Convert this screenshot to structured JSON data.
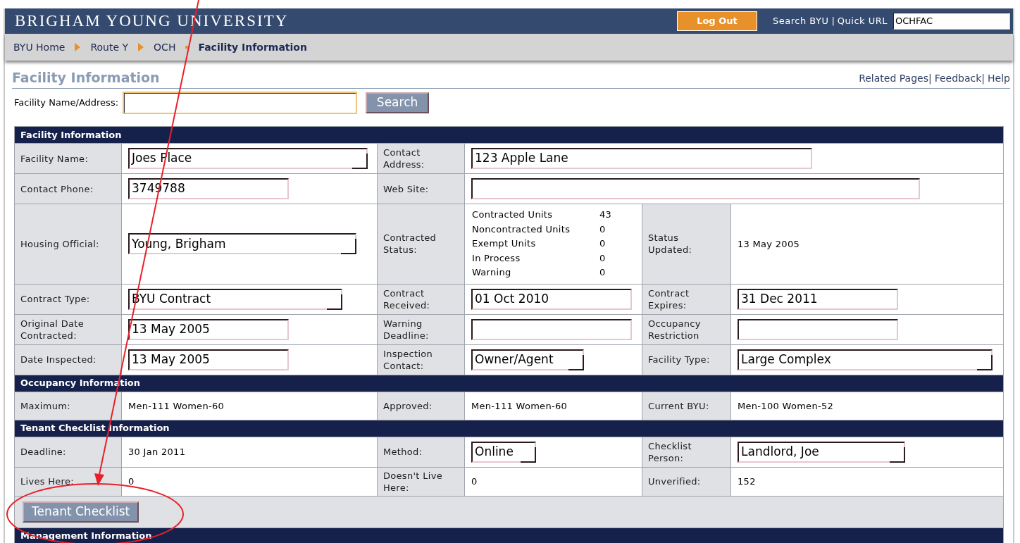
{
  "header": {
    "title": "BRIGHAM YOUNG UNIVERSITY",
    "logout": "Log Out",
    "search_link": "Search BYU",
    "separator": "|",
    "quick_url_label": "Quick URL",
    "quick_url": "OCHFAC"
  },
  "breadcrumb": [
    {
      "label": "BYU Home",
      "current": false
    },
    {
      "label": "Route Y",
      "current": false
    },
    {
      "label": "OCH",
      "current": false
    },
    {
      "label": "Facility Information",
      "current": true
    }
  ],
  "page": {
    "title": "Facility Information",
    "links": [
      "Related Pages|",
      "Feedback|",
      "Help"
    ]
  },
  "search": {
    "label": "Facility Name/Address:",
    "button": "Search"
  },
  "sections": [
    {
      "title": "Facility Information",
      "rows": [
        [
          {
            "kind": "label",
            "text": "Facility Name:"
          },
          {
            "kind": "select",
            "value": "Joes Place"
          },
          {
            "kind": "label",
            "text": "Contact Address:"
          },
          {
            "kind": "input",
            "value": "123 Apple Lane",
            "colspan": 3
          }
        ],
        [
          {
            "kind": "label",
            "text": "Contact Phone:"
          },
          {
            "kind": "input",
            "value": "3749788"
          },
          {
            "kind": "label",
            "text": "Web Site:"
          },
          {
            "kind": "input",
            "colspan": 3
          }
        ],
        [
          {
            "kind": "label",
            "text": "Housing Official:"
          },
          {
            "kind": "select",
            "value": "Young, Brigham"
          },
          {
            "kind": "label",
            "text": "Contracted Status:"
          },
          {
            "kind": "units",
            "items": [
              {
                "label": "Contracted Units",
                "value": "43"
              },
              {
                "label": "Noncontracted Units",
                "value": "0"
              },
              {
                "label": "Exempt Units",
                "value": "0"
              },
              {
                "label": "In Process",
                "value": "0"
              },
              {
                "label": "Warning",
                "value": "0"
              }
            ]
          },
          {
            "kind": "label",
            "text": "Status Updated:"
          },
          {
            "kind": "text",
            "text": "13 May 2005"
          }
        ],
        [
          {
            "kind": "label",
            "text": "Contract Type:"
          },
          {
            "kind": "select",
            "value": "BYU Contract"
          },
          {
            "kind": "label",
            "text": "Contract Received:"
          },
          {
            "kind": "input",
            "value": "01 Oct 2010"
          },
          {
            "kind": "label",
            "text": "Contract Expires:"
          },
          {
            "kind": "input",
            "value": "31 Dec 2011"
          }
        ],
        [
          {
            "kind": "label",
            "text": "Original Date Contracted:"
          },
          {
            "kind": "input",
            "value": "13 May 2005"
          },
          {
            "kind": "label",
            "text": "Warning Deadline:"
          },
          {
            "kind": "input"
          },
          {
            "kind": "label",
            "text": "Occupancy Restriction"
          },
          {
            "kind": "input"
          }
        ],
        [
          {
            "kind": "label",
            "text": "Date Inspected:"
          },
          {
            "kind": "input",
            "value": "13 May 2005"
          },
          {
            "kind": "label",
            "text": "Inspection Contact:"
          },
          {
            "kind": "select",
            "value": "Owner/Agent"
          },
          {
            "kind": "label",
            "text": "Facility Type:"
          },
          {
            "kind": "select",
            "value": "Large Complex"
          }
        ]
      ]
    },
    {
      "title": "Occupancy Information",
      "rows": [
        [
          {
            "kind": "label",
            "text": "Maximum:"
          },
          {
            "kind": "text",
            "text": "Men-111 Women-60"
          },
          {
            "kind": "label",
            "text": "Approved:"
          },
          {
            "kind": "text",
            "text": "Men-111 Women-60"
          },
          {
            "kind": "label",
            "text": "Current BYU:"
          },
          {
            "kind": "text",
            "text": "Men-100 Women-52"
          }
        ]
      ]
    },
    {
      "title": "Tenant Checklist Information",
      "rows": [
        [
          {
            "kind": "label",
            "text": "Deadline:"
          },
          {
            "kind": "text",
            "text": "30 Jan 2011"
          },
          {
            "kind": "label",
            "text": "Method:"
          },
          {
            "kind": "select",
            "value": "Online"
          },
          {
            "kind": "label",
            "text": "Checklist Person:"
          },
          {
            "kind": "select",
            "value": "Landlord, Joe"
          }
        ],
        [
          {
            "kind": "label",
            "text": "Lives Here:"
          },
          {
            "kind": "text",
            "text": "0"
          },
          {
            "kind": "label",
            "text": "Doesn't Live Here:"
          },
          {
            "kind": "text",
            "text": "0"
          },
          {
            "kind": "label",
            "text": "Unverified:"
          },
          {
            "kind": "text",
            "text": "152"
          }
        ],
        [
          {
            "kind": "button",
            "text": "Tenant Checklist",
            "colspan": 6
          }
        ]
      ]
    },
    {
      "title": "Management Information"
    }
  ]
}
